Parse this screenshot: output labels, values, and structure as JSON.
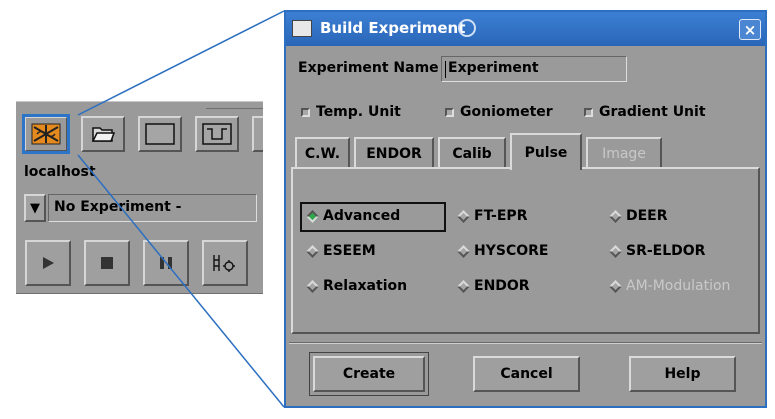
{
  "toolbar": {
    "hostname": "localhost",
    "experiment_select": "No Experiment -",
    "dropdown_arrow": "▼"
  },
  "dialog": {
    "title": "Build Experiment",
    "close_glyph": "×",
    "experiment_name_label": "Experiment Name",
    "experiment_name_value": "Experiment",
    "checkboxes": [
      {
        "label": "Temp. Unit",
        "checked": false
      },
      {
        "label": "Goniometer",
        "checked": false
      },
      {
        "label": "Gradient Unit",
        "checked": false
      }
    ],
    "tabs": [
      {
        "label": "C.W.",
        "state": "normal"
      },
      {
        "label": "ENDOR",
        "state": "normal"
      },
      {
        "label": "Calib",
        "state": "normal"
      },
      {
        "label": "Pulse",
        "state": "active"
      },
      {
        "label": "Image",
        "state": "disabled"
      }
    ],
    "pulse_options": [
      {
        "label": "Advanced",
        "selected": true,
        "enabled": true
      },
      {
        "label": "FT-EPR",
        "selected": false,
        "enabled": true
      },
      {
        "label": "DEER",
        "selected": false,
        "enabled": true
      },
      {
        "label": "ESEEM",
        "selected": false,
        "enabled": true
      },
      {
        "label": "HYSCORE",
        "selected": false,
        "enabled": true
      },
      {
        "label": "SR-ELDOR",
        "selected": false,
        "enabled": true
      },
      {
        "label": "Relaxation",
        "selected": false,
        "enabled": true
      },
      {
        "label": "ENDOR",
        "selected": false,
        "enabled": true
      },
      {
        "label": "AM-Modulation",
        "selected": false,
        "enabled": false
      }
    ],
    "buttons": {
      "create": "Create",
      "cancel": "Cancel",
      "help": "Help"
    }
  },
  "colors": {
    "title_bar": "#2a66b8",
    "selection_highlight": "#2b74c7",
    "panel_gray": "#9a9a9a",
    "selected_radio": "#2eaa4a"
  },
  "icons": [
    "new-experiment-icon",
    "open-folder-icon",
    "blank-window-icon",
    "signal-window-icon",
    "play-icon",
    "stop-icon",
    "pause-icon",
    "settings-icon",
    "app-icon",
    "swirl-icon",
    "close-icon"
  ]
}
